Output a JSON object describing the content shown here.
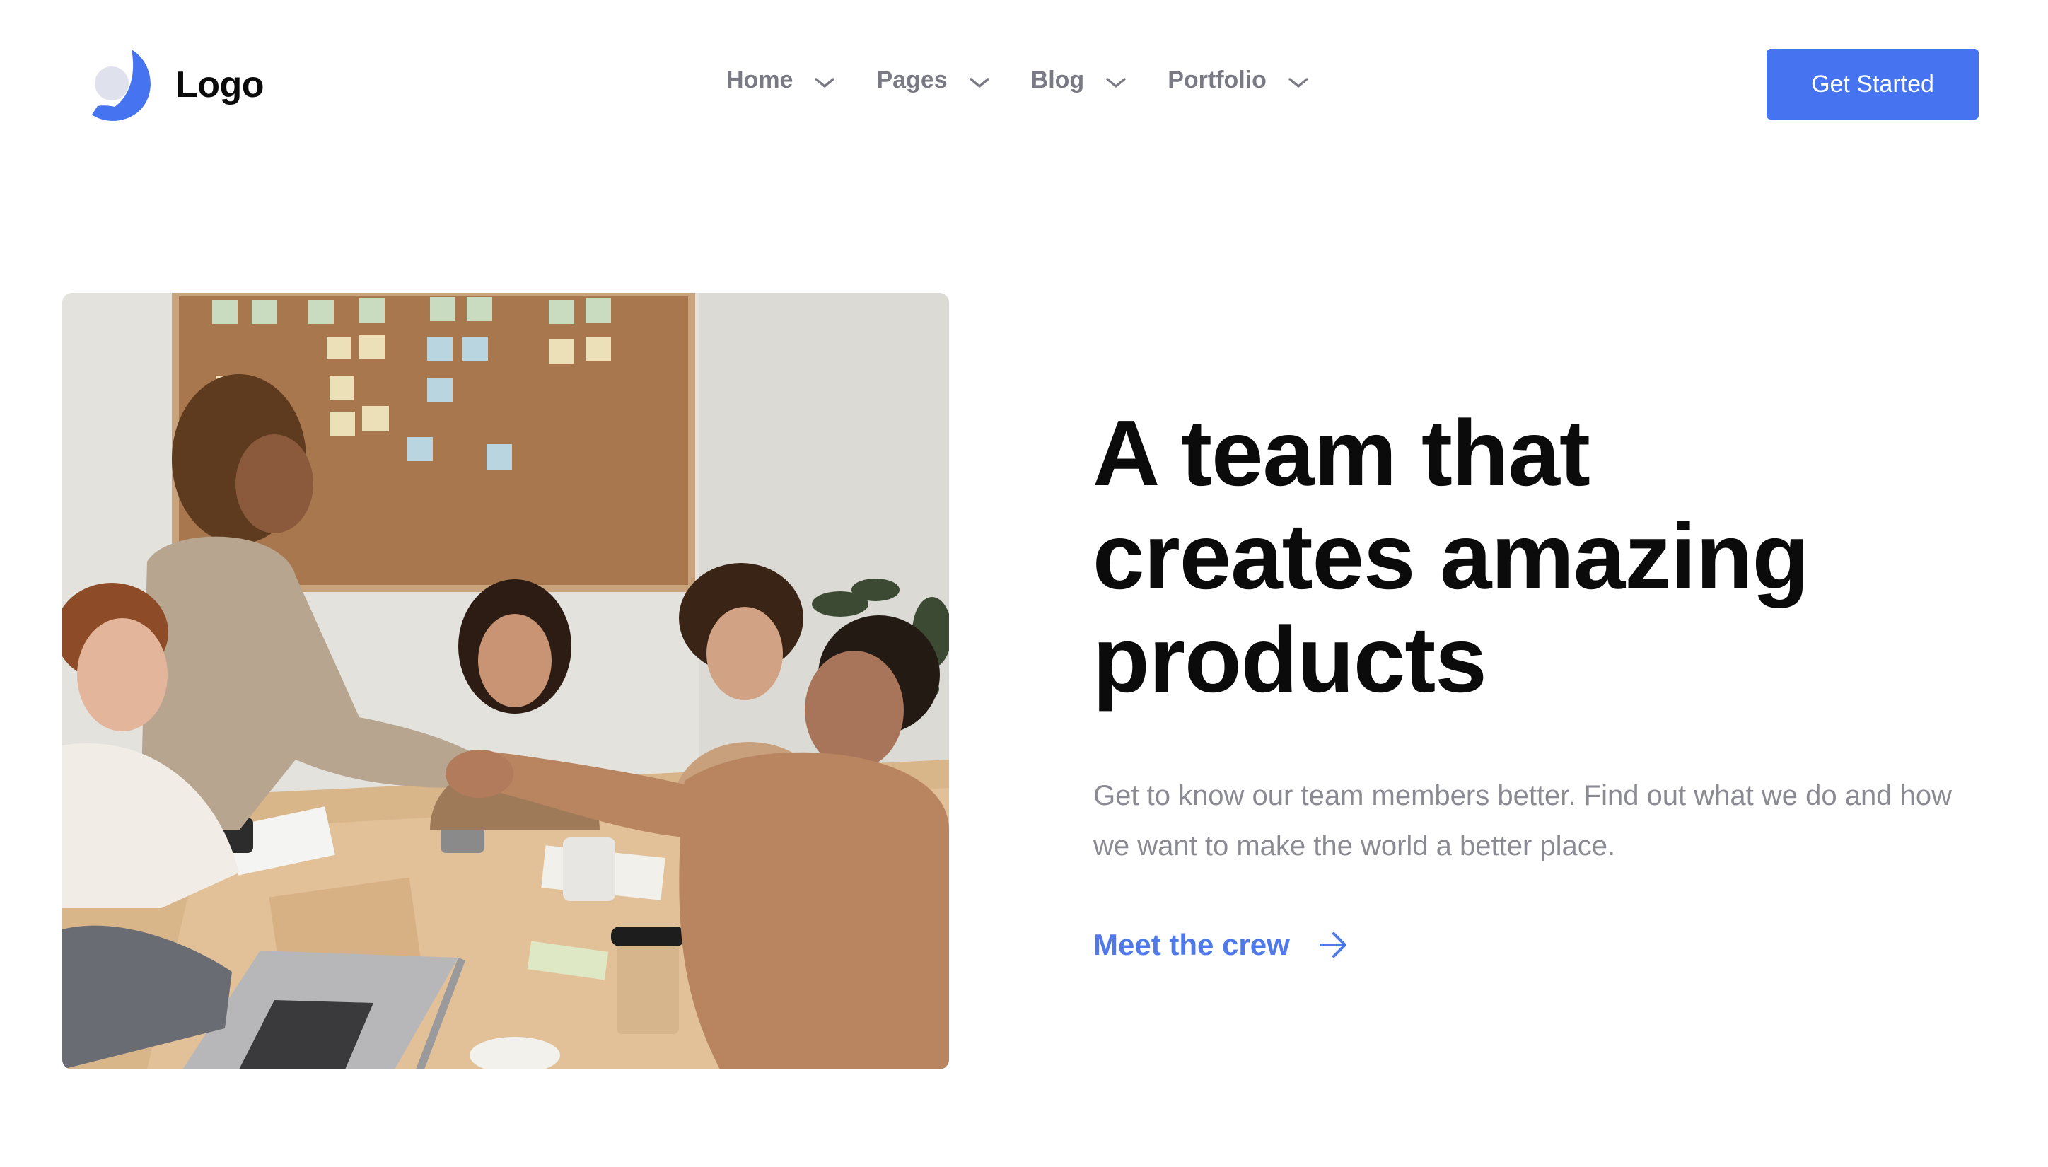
{
  "header": {
    "logo_text": "Logo",
    "nav": [
      {
        "label": "Home"
      },
      {
        "label": "Pages"
      },
      {
        "label": "Blog"
      },
      {
        "label": "Portfolio"
      }
    ],
    "cta_label": "Get Started"
  },
  "hero": {
    "title_lines": [
      "A team that",
      "creates amazing",
      "products"
    ],
    "description": "Get to know our team members better. Find out what we do and how we want to make the world a better place.",
    "link_label": "Meet the crew"
  },
  "colors": {
    "accent": "#4673f0",
    "link": "#4f78ea",
    "heading": "#0b0b0b",
    "muted_text": "#8a8a92",
    "nav_text": "#7a7a85"
  },
  "icons": {
    "logo": "crescent-logo-icon",
    "nav_dropdown": "chevron-down-icon",
    "link_arrow": "arrow-right-icon"
  }
}
